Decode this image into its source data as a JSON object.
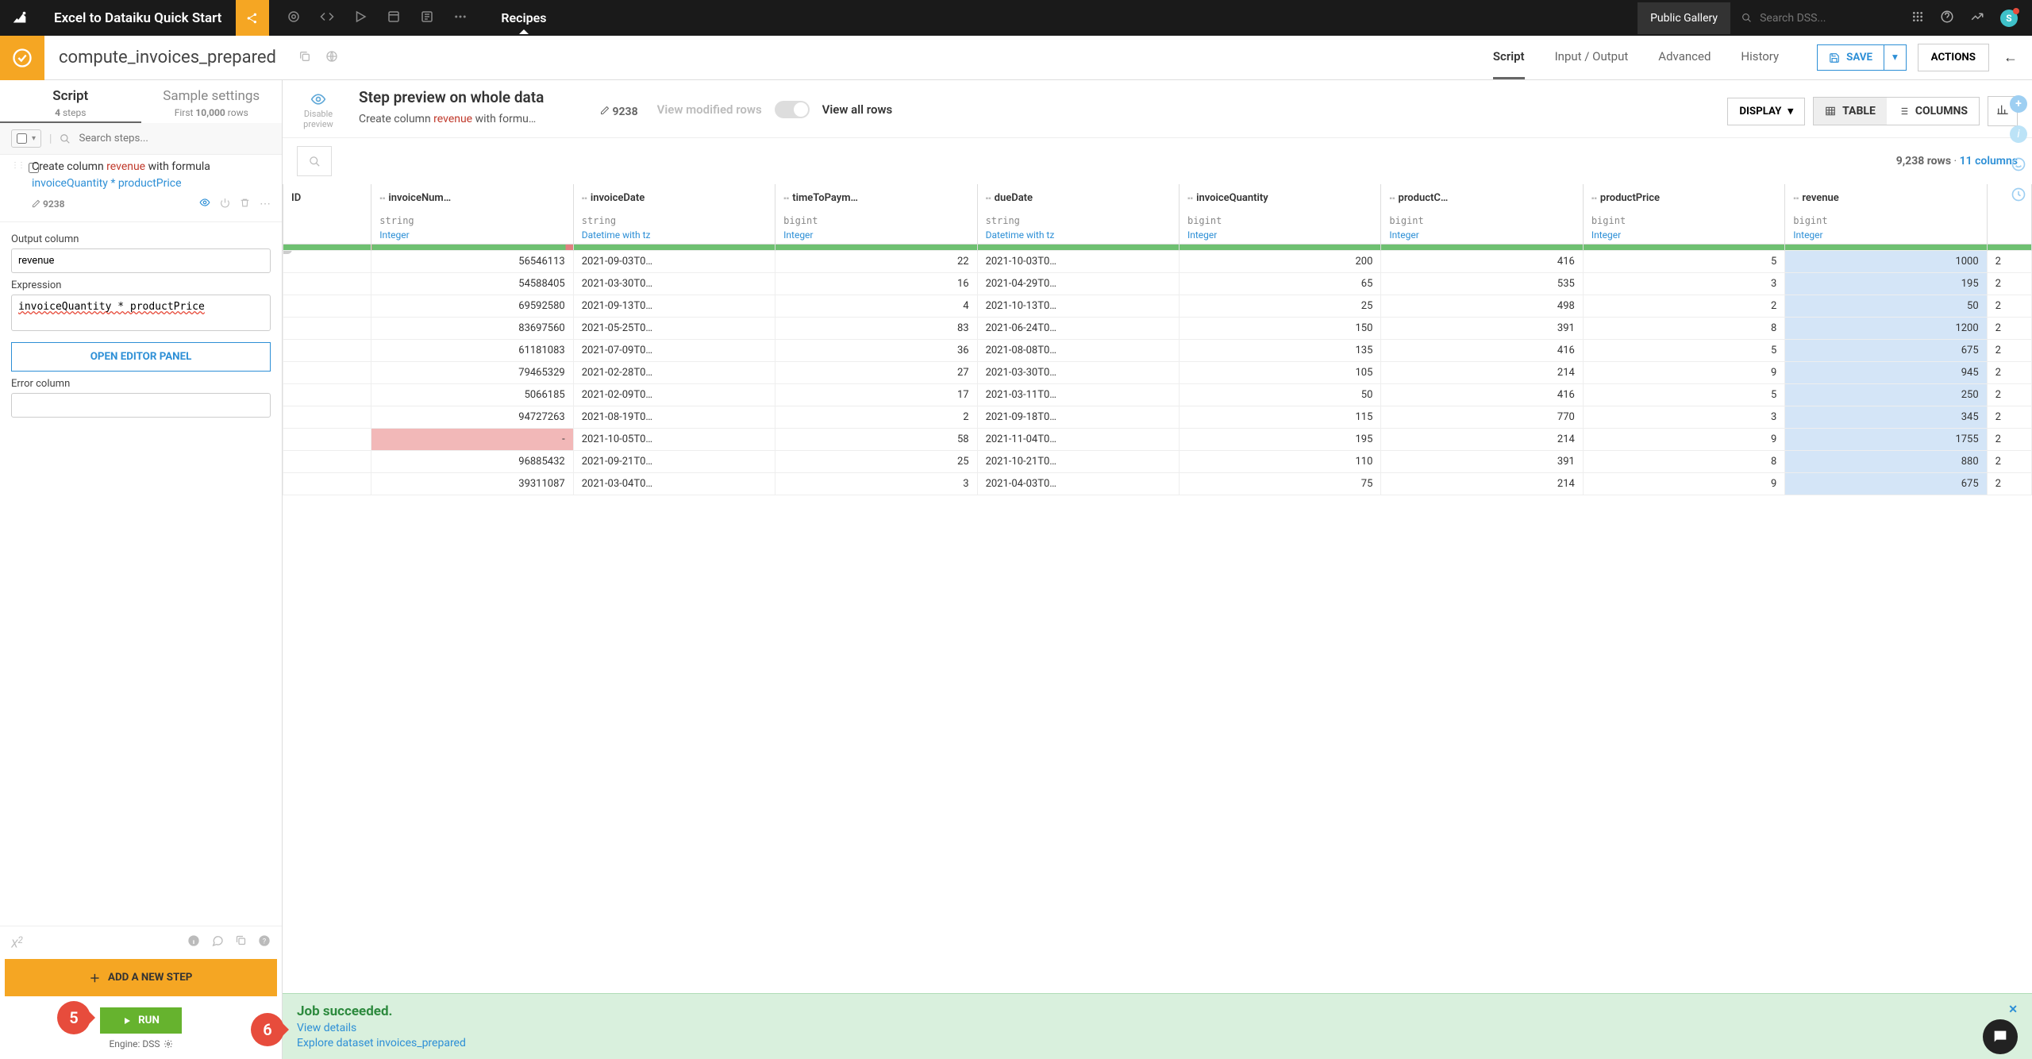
{
  "topbar": {
    "project_title": "Excel to Dataiku Quick Start",
    "recipes_label": "Recipes",
    "public_gallery": "Public Gallery",
    "search_placeholder": "Search DSS..."
  },
  "secondbar": {
    "recipe_name": "compute_invoices_prepared",
    "tabs": [
      "Script",
      "Input / Output",
      "Advanced",
      "History"
    ],
    "active_tab": "Script",
    "save": "SAVE",
    "actions": "ACTIONS"
  },
  "left_panel": {
    "tab_script": "Script",
    "tab_script_sub_count": "4",
    "tab_script_sub_label": " steps",
    "tab_sample": "Sample settings",
    "tab_sample_sub_prefix": "First ",
    "tab_sample_sub_count": "10,000",
    "tab_sample_sub_suffix": " rows",
    "search_placeholder": "Search steps...",
    "step_desc_1": "Create column ",
    "step_desc_col": "revenue",
    "step_desc_2": " with formula ",
    "step_desc_formula": "invoiceQuantity * productPrice",
    "step_count": "9238",
    "output_label": "Output column",
    "output_value": "revenue",
    "expr_label": "Expression",
    "expr_value": "invoiceQuantity * productPrice",
    "editor_btn": "OPEN EDITOR PANEL",
    "error_label": "Error column",
    "add_step": "ADD A NEW STEP",
    "run": "RUN",
    "engine": "Engine: DSS"
  },
  "preview": {
    "disable": "Disable preview",
    "title": "Step preview on whole data",
    "sub_1": "Create column ",
    "sub_col": "revenue",
    "sub_2": " with formu…",
    "row_count": "9238",
    "view_modified": "View modified rows",
    "view_all": "View all rows",
    "display": "DISPLAY",
    "table": "TABLE",
    "columns": "COLUMNS"
  },
  "table_meta": {
    "rows": "9,238 rows",
    "cols": "11 columns"
  },
  "columns": [
    {
      "name": "ID",
      "storage": "",
      "meaning": ""
    },
    {
      "name": "invoiceNum…",
      "storage": "string",
      "meaning": "Integer"
    },
    {
      "name": "invoiceDate",
      "storage": "string",
      "meaning": "Datetime with tz"
    },
    {
      "name": "timeToPaym…",
      "storage": "bigint",
      "meaning": "Integer"
    },
    {
      "name": "dueDate",
      "storage": "string",
      "meaning": "Datetime with tz"
    },
    {
      "name": "invoiceQuantity",
      "storage": "bigint",
      "meaning": "Integer"
    },
    {
      "name": "productC…",
      "storage": "bigint",
      "meaning": "Integer"
    },
    {
      "name": "productPrice",
      "storage": "bigint",
      "meaning": "Integer"
    },
    {
      "name": "revenue",
      "storage": "bigint",
      "meaning": "Integer"
    }
  ],
  "rows": [
    {
      "num": "56546113",
      "idate": "2021-09-03T0…",
      "ttp": "22",
      "ddate": "2021-10-03T0…",
      "qty": "200",
      "pc": "416",
      "pp": "5",
      "rev": "1000",
      "tail": "2"
    },
    {
      "num": "54588405",
      "idate": "2021-03-30T0…",
      "ttp": "16",
      "ddate": "2021-04-29T0…",
      "qty": "65",
      "pc": "535",
      "pp": "3",
      "rev": "195",
      "tail": "2"
    },
    {
      "num": "69592580",
      "idate": "2021-09-13T0…",
      "ttp": "4",
      "ddate": "2021-10-13T0…",
      "qty": "25",
      "pc": "498",
      "pp": "2",
      "rev": "50",
      "tail": "2"
    },
    {
      "num": "83697560",
      "idate": "2021-05-25T0…",
      "ttp": "83",
      "ddate": "2021-06-24T0…",
      "qty": "150",
      "pc": "391",
      "pp": "8",
      "rev": "1200",
      "tail": "2"
    },
    {
      "num": "61181083",
      "idate": "2021-07-09T0…",
      "ttp": "36",
      "ddate": "2021-08-08T0…",
      "qty": "135",
      "pc": "416",
      "pp": "5",
      "rev": "675",
      "tail": "2"
    },
    {
      "num": "79465329",
      "idate": "2021-02-28T0…",
      "ttp": "27",
      "ddate": "2021-03-30T0…",
      "qty": "105",
      "pc": "214",
      "pp": "9",
      "rev": "945",
      "tail": "2"
    },
    {
      "num": "5066185",
      "idate": "2021-02-09T0…",
      "ttp": "17",
      "ddate": "2021-03-11T0…",
      "qty": "50",
      "pc": "416",
      "pp": "5",
      "rev": "250",
      "tail": "2"
    },
    {
      "num": "94727263",
      "idate": "2021-08-19T0…",
      "ttp": "2",
      "ddate": "2021-09-18T0…",
      "qty": "115",
      "pc": "770",
      "pp": "3",
      "rev": "345",
      "tail": "2"
    },
    {
      "num": "-",
      "idate": "2021-10-05T0…",
      "ttp": "58",
      "ddate": "2021-11-04T0…",
      "qty": "195",
      "pc": "214",
      "pp": "9",
      "rev": "1755",
      "tail": "2",
      "red": true
    },
    {
      "num": "96885432",
      "idate": "2021-09-21T0…",
      "ttp": "25",
      "ddate": "2021-10-21T0…",
      "qty": "110",
      "pc": "391",
      "pp": "8",
      "rev": "880",
      "tail": "2"
    },
    {
      "num": "39311087",
      "idate": "2021-03-04T0…",
      "ttp": "3",
      "ddate": "2021-04-03T0…",
      "qty": "75",
      "pc": "214",
      "pp": "9",
      "rev": "675",
      "tail": "2"
    }
  ],
  "job": {
    "title": "Job succeeded.",
    "view_details": "View details",
    "explore": "Explore dataset invoices_prepared"
  },
  "callouts": {
    "c5": "5",
    "c6": "6"
  }
}
